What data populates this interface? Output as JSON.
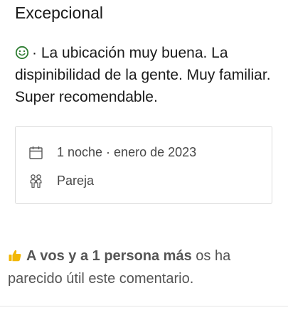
{
  "review": {
    "rating_label": "Excepcional",
    "separator": "·",
    "text": "La ubicación muy buena. La dispinibilidad de la gente. Muy familiar. Super recomendable."
  },
  "stay": {
    "duration": "1 noche · enero de 2023",
    "traveler_type": "Pareja"
  },
  "helpful": {
    "strong": "A vos y a 1 persona más",
    "rest": "os ha parecido útil este comentario."
  },
  "colors": {
    "positive_icon": "#2e7d32",
    "thumb_icon": "#f2b705",
    "card_border": "#dcdcdc",
    "meta_text": "#474747"
  }
}
